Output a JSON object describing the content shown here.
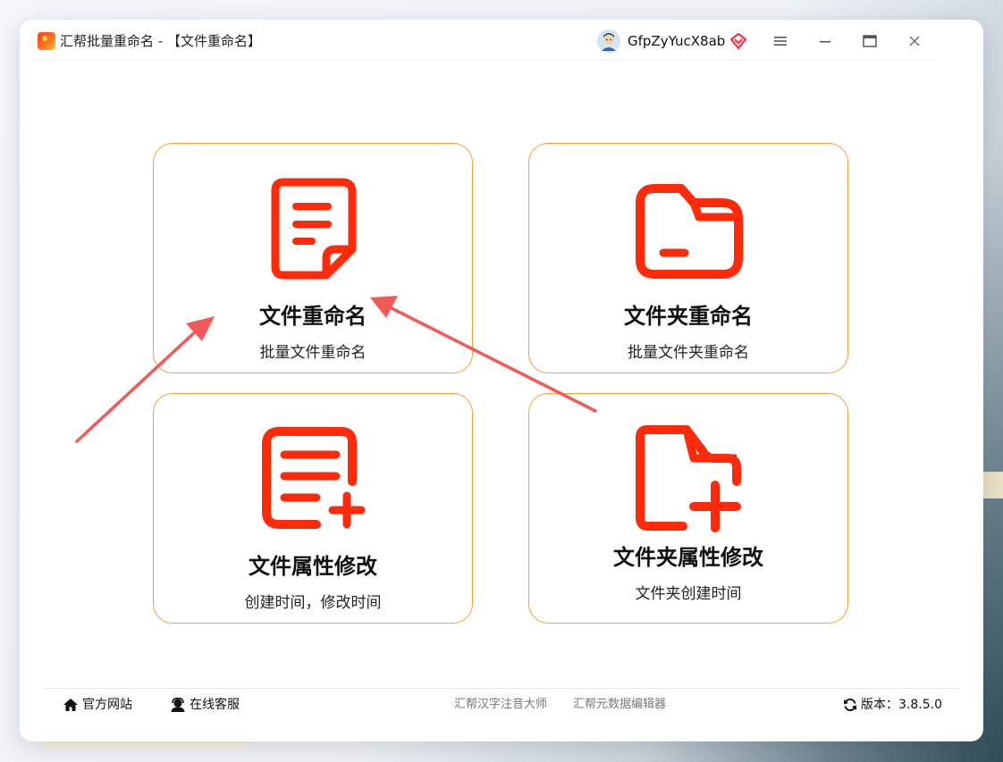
{
  "window": {
    "title": "汇帮批量重命名 - 【文件重命名】",
    "username": "GfpZyYucX8ab"
  },
  "cards": [
    {
      "title": "文件重命名",
      "subtitle": "批量文件重命名",
      "icon": "document-icon"
    },
    {
      "title": "文件夹重命名",
      "subtitle": "批量文件夹重命名",
      "icon": "folder-icon"
    },
    {
      "title": "文件属性修改",
      "subtitle": "创建时间，修改时间",
      "icon": "document-add-icon"
    },
    {
      "title": "文件夹属性修改",
      "subtitle": "文件夹创建时间",
      "icon": "folder-add-icon"
    }
  ],
  "footer": {
    "website": "官方网站",
    "service": "在线客服",
    "link1": "汇帮汉字注音大师",
    "link2": "汇帮元数据编辑器",
    "version": "版本：3.8.5.0"
  },
  "colors": {
    "accent": "#ff2a0a",
    "card_border": "#f0a43a",
    "arrow": "#f25a5a"
  }
}
